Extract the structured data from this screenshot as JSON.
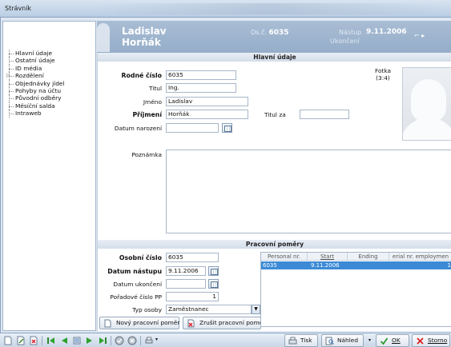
{
  "window": {
    "title": "Strávník"
  },
  "nav": {
    "items": [
      {
        "label": "Hlavní údaje"
      },
      {
        "label": "Ostatní údaje"
      },
      {
        "label": "ID média"
      },
      {
        "label": "Rozdělení"
      },
      {
        "label": "Objednávky jídel"
      },
      {
        "label": "Pohyby na účtu"
      },
      {
        "label": "Původní odběry"
      },
      {
        "label": "Měsíční salda"
      },
      {
        "label": "Intraweb"
      }
    ]
  },
  "header": {
    "first_name": "Ladislav",
    "last_name": "Horňák",
    "osc_label": "Os.č.",
    "osc_value": "6035",
    "nastup_label": "Nástup",
    "nastup_value": "9.11.2006",
    "ukonceni_label": "Ukončení"
  },
  "main": {
    "section_title": "Hlavní údaje",
    "fields": {
      "rodne_cislo": {
        "label": "Rodné číslo",
        "value": "6035"
      },
      "titul": {
        "label": "Titul",
        "value": "Ing."
      },
      "jmeno": {
        "label": "Jméno",
        "value": "Ladislav"
      },
      "prijmeni": {
        "label": "Příjmení",
        "value": "Horňák"
      },
      "titul_za": {
        "label": "Titul za",
        "value": ""
      },
      "datum_narozeni": {
        "label": "Datum narození",
        "value": ""
      },
      "poznamka": {
        "label": "Poznámka",
        "value": ""
      }
    },
    "photo_label": "Fotka\n(3:4)"
  },
  "employment": {
    "section_title": "Pracovní poměry",
    "osobni_cislo": {
      "label": "Osobní číslo",
      "value": "6035"
    },
    "datum_nastupu": {
      "label": "Datum nástupu",
      "value": "9.11.2006"
    },
    "datum_ukonceni": {
      "label": "Datum ukončení",
      "value": ""
    },
    "poradove_cislo": {
      "label": "Pořadové číslo PP",
      "value": "1"
    },
    "typ_osoby": {
      "label": "Typ osoby",
      "value": "Zaměstnanec"
    },
    "grid": {
      "columns": [
        "Personal nr.",
        "Start",
        "Ending",
        "erial nr. employmen"
      ],
      "rows": [
        {
          "personal": "6035",
          "start": "9.11.2006",
          "ending": "",
          "serial": "1"
        }
      ]
    },
    "buttons": {
      "add": "Nový pracovní poměr",
      "cancel": "Zrušit pracovní poměr"
    }
  },
  "toolbar": {
    "print": "Tisk",
    "preview": "Náhled",
    "ok": "OK",
    "storno": "Storno"
  },
  "colors": {
    "accent": "#3c8ad6",
    "header_bg": "#a4b9d1"
  }
}
